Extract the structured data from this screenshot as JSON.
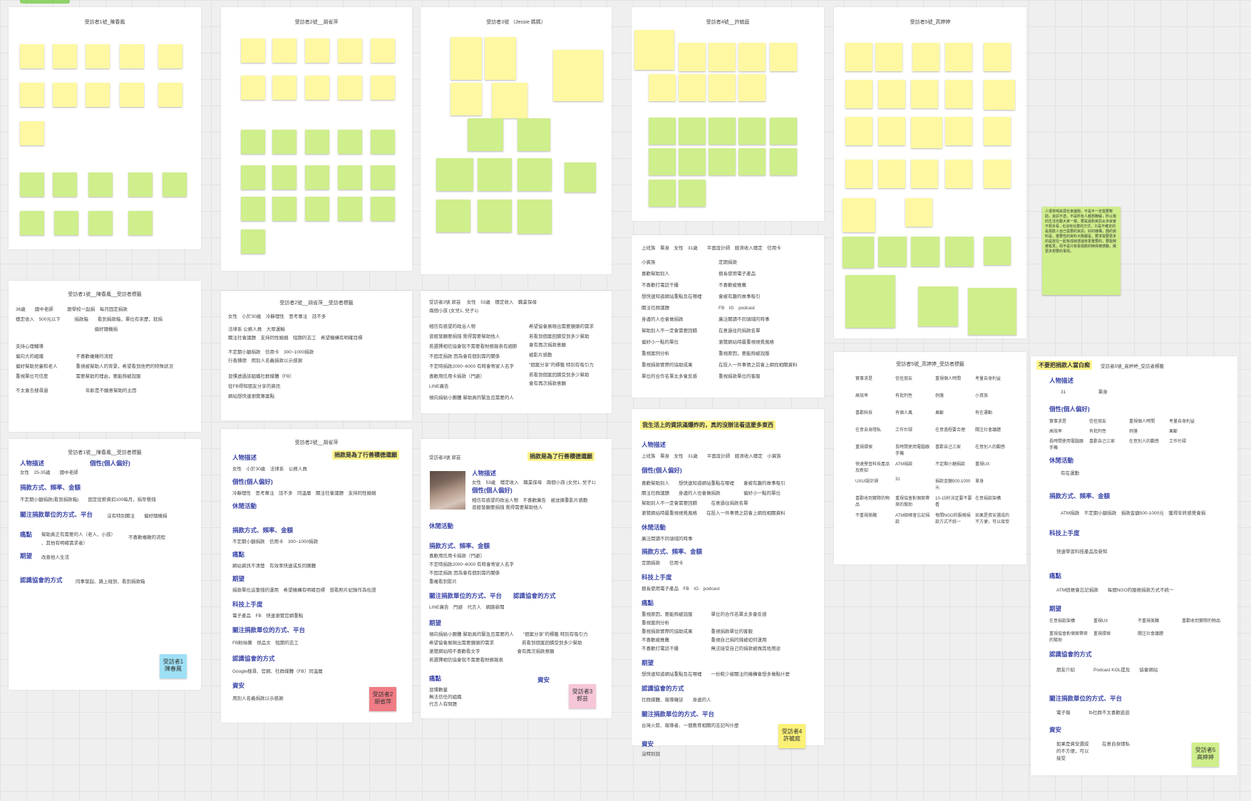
{
  "boards": {
    "b1": "受訪者1號_陳春鳳",
    "b2": "受訪者2號__胡省萍",
    "b3": "受訪者3號 （Jessie 媽媽）",
    "b4": "受訪者4號__許毓庭",
    "b5": "受訪者5號_高婷婷"
  },
  "tags_panel": {
    "t1": "受訪者1號__陳春鳳__受訪者標籤",
    "t2": "受訪者2號__胡省萍__受訪者標籤",
    "t3": "受訪者3號 郭芸　 女性　53歲　穩定收入　職業保母",
    "t3b": "兩個小孩 (女兒1, 兒子1)",
    "t5": "受訪者5號_高婷婷_受訪者標籤"
  },
  "p1": {
    "lines": [
      "36歲　　國中老師　　　跟學校一起捐　每月固定捐款",
      "穩定收入　500元以下　　　捐款箱　　看到捐款箱，單位有來歷，就捐",
      "　　　　　　　　　　　　　　　　　偏好隨機捐",
      "支持心理輔導",
      "偏向大的組織　　　　　　　不喜歡複雜的流程",
      "偏好幫助兒童和老人　　　　重視被幫助人的背景，希望看到他們的特殊狀況",
      "重視單位可信度　　　　　　需要幫助的理由，要能夠被說服",
      "不太會去搜尋過",
      "年齡是不願意幫助的主因"
    ]
  },
  "p2": {
    "lines": [
      "女性　小於30歲　冷靜理性　思考專注　話不多",
      "法律系 公務人員　大眾運輸",
      "關注社會議題　支持同性婚姻　短期的志工　希望機構有明確目標",
      "不定期小額捐款　信用卡　300~1000捐款",
      "行善積德　用別人名義捐款以示感謝",
      "習慣透過該組織社群媒體（FB）",
      "從FB得知朋友分享的資訊",
      "網站想快速瀏覽專案點"
    ]
  },
  "p3": {
    "lines_left": [
      "相信有感望的政治人物",
      "曾經發願要捐錢 覺得需要幫助他人",
      "若選擇相信協會就不需要看財務報表有細節",
      "不固定捐款 因為會有個別需的關係",
      "不定時捐款2000~6000 有時會寄家人名字",
      "喜歡用信用卡捐款（門避）",
      "LINE廣告",
      "傾向捐給小團體 幫助真的緊急且需要的人"
    ],
    "lines_right": [
      "希望協會展現出需要鏡頭的需求",
      "若看到個案回饋受到多少幫助",
      "會有再次捐款意願",
      "被影片感動",
      "\"個案分享\"的標籤 特別有吸引力",
      "若看到個案回饋受到多少幫助",
      "會有再次捐款意願"
    ]
  },
  "p4": {
    "header": "上班族　單身　女性　31歲　　平面設計師　經濟收入穩定　信用卡",
    "lines_left": [
      "小資族",
      "喜歡幫助別人",
      "不喜歡打電話干擾",
      "想快速知道網站重點及在哪裡",
      "關注社群議題",
      "身邊的人也會做捐款",
      "幫助別人不一定會需要回饋",
      "偏好小一點的單位",
      "重視案例分析",
      "重視捐款實際的協助成果",
      "單位的合作名單太多會反感"
    ],
    "lines_right": [
      "定期捐款",
      "擅長使用電子產品",
      "不喜歡被推薦",
      "會被有趣的故事吸引",
      "FB　IG　podcast",
      "廣泛關讀不同領域的時事",
      "在意過往的捐款名單",
      "瀏覽網站時最重視視覺風格",
      "重視原因，要能夠被說服",
      "在投入一件事情之前會上網找相關資料",
      "重視捐款單位的客服"
    ]
  },
  "p5": {
    "rows": [
      [
        "實事求是",
        "信任朋友",
        "重視個人時間",
        "考量自身利益"
      ],
      [
        "高效率",
        "有批判性",
        "例落",
        "小資族"
      ],
      [
        "喜歡科技",
        "有個人風",
        "果斷",
        "有在運動"
      ],
      [
        "在意自身隱私",
        "工作忙碌",
        "在意過程要合理",
        "關注社會議題"
      ],
      [
        "重視環保",
        "長時間使用電腦跟手機",
        "喜歡自己三家",
        "在意別人的觀感"
      ],
      [
        "快速學習科技產品及新知",
        "ATM捐款",
        "不定期小額捐款",
        "重視UX"
      ],
      [
        "UXUI設計師",
        "31",
        "捐款金額500-1000元",
        "單身"
      ],
      [
        "喜歡收到實際的物品",
        "重視協會對個案帶來的幫助",
        "10-15秒決定要不要看",
        "在意捐款架構"
      ],
      [
        "不重視美醜",
        "ATM鈕帳會忘記捐款",
        "每間NGO的服務捐款方式不統一",
        "如果是資安選成的不方便，可以接受"
      ]
    ],
    "last": "如果是資安選成的不方便，可以接受"
  },
  "pers1": {
    "title": "受訪者1號__陳春鳳__受訪者標籤",
    "h_desc": "人物描述",
    "desc": "女性　25-35歲　　國中老師",
    "h_trait": "個性(個人偏好)",
    "h_pay": "捐款方式、頻率、金額",
    "pay": "不定期小額捐款(看到捐款箱)　　固定從薪資扣100每月，捐早餐錢",
    "h_unit": "關注捐款單位的方式、平台",
    "unit": "沒有特別關注　　偏好隨機捐",
    "h_pain": "痛點",
    "pain1": "幫助真正有需要的人（老人、小孩）",
    "pain2": "、其他有明確需求者）",
    "pain3": "不喜歡複雜的流程",
    "h_hope": "期望",
    "hope": "改善他人生活",
    "h_know": "認識協會的方式",
    "know": "同事發起、路上碰到、看到捐款箱",
    "tag": "受訪者1\n陳春鳳"
  },
  "pers2": {
    "title": "受訪者2號__胡省萍",
    "hl": "捐款是為了行善積德還願",
    "h_desc": "人物描述",
    "desc": "女性　小於30歲　法律系　公務人員",
    "h_trait": "個性(個人偏好)",
    "trait": "冷靜理性　思考專注　話不多　同溫層　關注社會議題　支持同性婚姻",
    "h_act": "休閒活動",
    "h_pay": "捐款方式、頻率、金額",
    "pay": "不定期小額捐款　信用卡　300~1000捐款",
    "h_pain": "痛點",
    "pain": "網站資訊不清楚　有效率快速或反同團體",
    "h_hope": "期望",
    "hope": "捐款單位這筆錢的運用　希望機構有明確目標　想看照片紀錄作為佐證",
    "h_tech": "科技上手度",
    "tech": "電子產品　FB　快速瀏覽官網重點",
    "h_unit": "關注捐款單位的方式、平台",
    "unit": "FB粉絲團　很品文　短期的志工",
    "h_know": "認識協會的方式",
    "know": "Google搜尋、官網、社群媒體（FB）同溫層",
    "h_asset": "資安",
    "asset": "用別人名義捐款以示感謝",
    "tag": "受訪者2\n胡省萍"
  },
  "pers3": {
    "title": "受訪者3號 郭芸",
    "hl": "捐款是為了行善積德還願",
    "h_desc": "人物描述",
    "desc": "女性　53歲　穩定收入　職業保母　兩個小孩 (女兒1, 兒子1)",
    "h_trait": "個性(個人偏好)",
    "trait1": "相信有感望的政治人物　不喜歡廣告　被送揀重影片感動",
    "trait2": "曾經發願要捐錢 覺得需要幫助他人",
    "h_act": "休閒活動",
    "h_pay": "捐款方式、頻率、金額",
    "pay1": "喜歡用信用卡捐款（門避）",
    "pay2": "不定時捐款2000~6000 有時會寄家人名字",
    "pay3": "不固定捐款 因為會有個別需的關係",
    "pay4": "重複看到影片",
    "h_unit": "關注捐款單位的方式、平台",
    "h_know": "認識協會的方式",
    "know": "LINE廣告　門避　代言人　網路新聞",
    "h_hope": "期望",
    "hope1": "傾向捐給小團體 幫助真的緊急且需要的人　　\"個案分享\"的標籤 特別有吸引力",
    "hope2": "希望協會展現出需要鏡頭的需求　　　　　　若看到個案回饋受到多少幫助",
    "hope3": "瀏覽網站時不喜歡看文字　　　　　　　　會有再次捐款意願",
    "hope4": "若選擇相信協會就不需要看財務報表",
    "h_pain": "痛點",
    "pain1": "習慣數量",
    "pain2": "無法信任的組織",
    "pain3": "代言人有問題",
    "h_asset": "資安",
    "tag": "受訪者3\n郭芸"
  },
  "pers4": {
    "hl": "我生活上的資訊滿爆炸的，真的沒辦法看這麼多東西",
    "h_desc": "人物描述",
    "desc": "上班族　單身　女性　31歲　　平面設計師　經濟收入穩定　小資族",
    "h_trait": "個性(個人偏好)",
    "trait": [
      "喜歡幫助別人　　想快速知道網站重點在哪裡　　會被有趣的故事吸引",
      "關注社群議題　　身邊的人也會做捐款　　　　　偏好小一點的單位",
      "幫助別人不一定會需要回饋　　　在意過往捐款名單",
      "瀏覽網站時最重視視覺風格　　在投入一件事情之前會上網找相關資料"
    ],
    "h_act": "休閒活動",
    "act": "廣泛閱讀不同領域的時事",
    "h_pay": "捐款方式、頻率、金額",
    "pay": "定期捐款　　信用卡",
    "h_tech": "科技上手度",
    "tech": "擅長使用電子產品　FB　IG　podcast",
    "h_pain": "痛點",
    "pain": [
      "重視原因，要能夠被說服　　　　單位的合作名單太多會反感",
      "重視案例分析",
      "重視捐款實際的協助成果　　　　重視捐款單位的客服",
      "不喜歡被推薦　　　　　　　　　重視自己捐的錢被如何運用",
      "不喜歡打電話干擾　　　　　　　無法接受自己的捐款被做其他用途"
    ],
    "h_hope": "期望",
    "hope": "想快速知道網站重點及在哪裡　　一份較少被關注的機構會想多做點什麼",
    "h_know": "認識協會的方式",
    "know": "社群媒體、報導雜誌　　身邊的人",
    "h_unit": "關注捐款單位的方式、平台",
    "unit": "台灣火箭、報導者、一個教育相關的志記叫什麼",
    "h_asset": "資安",
    "asset": "沒特別說",
    "tag": "受訪者4\n許毓庭"
  },
  "pers5": {
    "hl": "不要把捐款人當白痴",
    "title": "受訪者5號_高婷婷_受訪者標籤",
    "h_desc": "人物描述",
    "desc": "31　　　　　　　單身",
    "h_trait": "個性(個人偏好)",
    "trait": [
      [
        "實事求是",
        "信任朋友",
        "重視個人時間",
        "考量自身利益"
      ],
      [
        "高效率",
        "有批判性",
        "例落",
        "果斷"
      ],
      [
        "長時間使用電腦跟手機",
        "喜歡自己三家",
        "在意別人的觀感",
        "工作忙碌"
      ]
    ],
    "h_act": "休閒活動",
    "act": "有在運動",
    "h_pay": "捐款方式、頻率、金額",
    "pay": "ATM捐款　不定期小額捐款　捐款金額500-1000元　獲得年終感覺會捐",
    "h_tech": "科技上手度",
    "tech": "快速學習科技產品及新知",
    "h_pain": "痛點",
    "pain": "ATM鈕帳會忘記捐款　　每間NGO的服務捐款方式不統一",
    "h_hope": "期望",
    "hope": [
      [
        "在意捐款架構",
        "重視UX",
        "不重視美醜",
        "喜歡收到實際的物品"
      ],
      [
        "重視協會對個案帶來的幫助",
        "重視環保",
        "關注社會議題"
      ]
    ],
    "h_know": "認識協會的方式",
    "know": "朋友介紹　　　　Podcast KOL提及　　協會網站",
    "h_unit": "關注捐款單位的方式、平台",
    "unit": "電子報　　　　fb社群不太喜歡逛逛",
    "h_asset": "資安",
    "asset1": "如果是資安選成",
    "asset2": "的不方便，可以",
    "asset3": "接受",
    "asset_r": "在意自身隱私",
    "tag": "受訪者5\n高婷婷"
  },
  "side_note": "人很常喝資源社會議題，不是平一定需要幫助，資訊不透，不是所有人都想瞭解，所以我的生活也跟大家一樣，要是過對資訊太多就會不想多看...也沒有社群的方式，只是不確定的是捐款人自己需要的資訊。好的機構，團的資料是，重要性的資料大概都是，要求需要更多的是放在一起有成就感還有更重要的，要能夠被看見，而不是只有看捐款的時候被感動，做更多想要的事情。",
  "colors": {
    "yellow": "#fef8a3",
    "green": "#cfee8c",
    "heading": "#3b46a8",
    "tag_blue": "#9ee0f5",
    "tag_red": "#f07c85",
    "tag_pink": "#f5c6d8",
    "tag_yellow": "#fbf176",
    "tag_green": "#cfee8c"
  }
}
